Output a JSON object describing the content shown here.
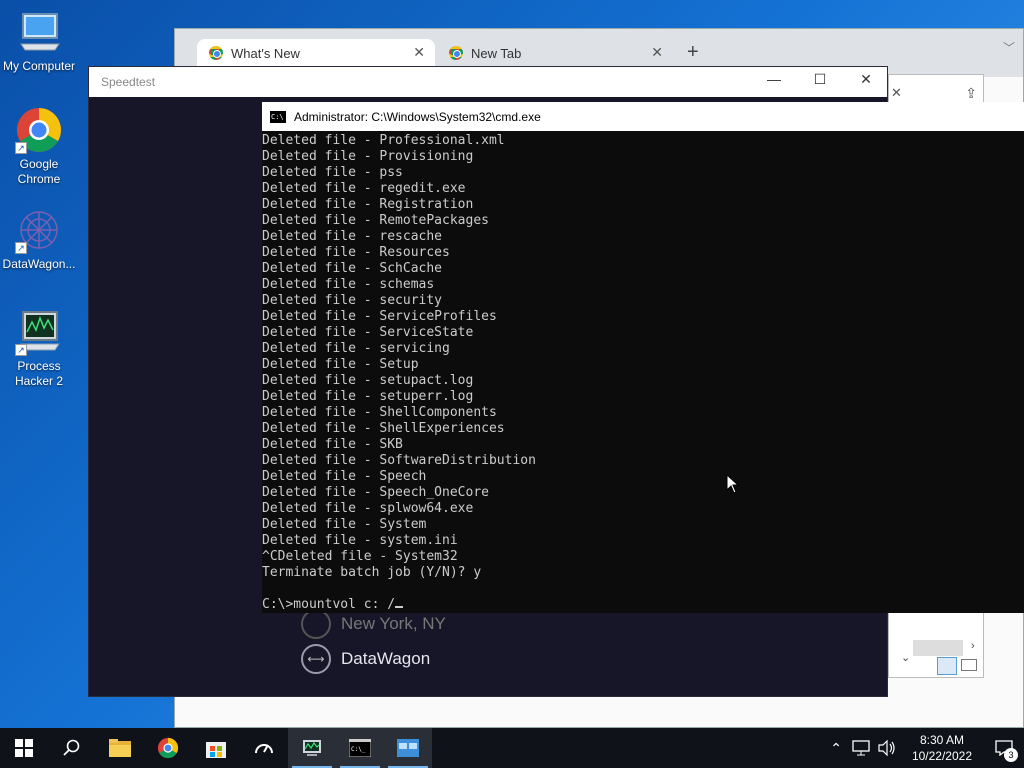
{
  "desktop": {
    "icons": [
      {
        "label": "My Computer"
      },
      {
        "label": "Google Chrome"
      },
      {
        "label": "DataWagon..."
      },
      {
        "label": "Process Hacker 2"
      }
    ]
  },
  "browser": {
    "tabs": [
      {
        "label": "What's New"
      },
      {
        "label": "New Tab"
      }
    ]
  },
  "speedtest": {
    "title": "Speedtest",
    "location": "New York, NY",
    "host": "DataWagon"
  },
  "cmd": {
    "title": "Administrator:  C:\\Windows\\System32\\cmd.exe",
    "lines": [
      "Deleted file - Professional.xml",
      "Deleted file - Provisioning",
      "Deleted file - pss",
      "Deleted file - regedit.exe",
      "Deleted file - Registration",
      "Deleted file - RemotePackages",
      "Deleted file - rescache",
      "Deleted file - Resources",
      "Deleted file - SchCache",
      "Deleted file - schemas",
      "Deleted file - security",
      "Deleted file - ServiceProfiles",
      "Deleted file - ServiceState",
      "Deleted file - servicing",
      "Deleted file - Setup",
      "Deleted file - setupact.log",
      "Deleted file - setuperr.log",
      "Deleted file - ShellComponents",
      "Deleted file - ShellExperiences",
      "Deleted file - SKB",
      "Deleted file - SoftwareDistribution",
      "Deleted file - Speech",
      "Deleted file - Speech_OneCore",
      "Deleted file - splwow64.exe",
      "Deleted file - System",
      "Deleted file - system.ini",
      "^CDeleted file - System32",
      "Terminate batch job (Y/N)? y",
      ""
    ],
    "prompt": "C:\\>mountvol c: /"
  },
  "taskbar": {
    "time": "8:30 AM",
    "date": "10/22/2022",
    "notification_count": "3"
  }
}
